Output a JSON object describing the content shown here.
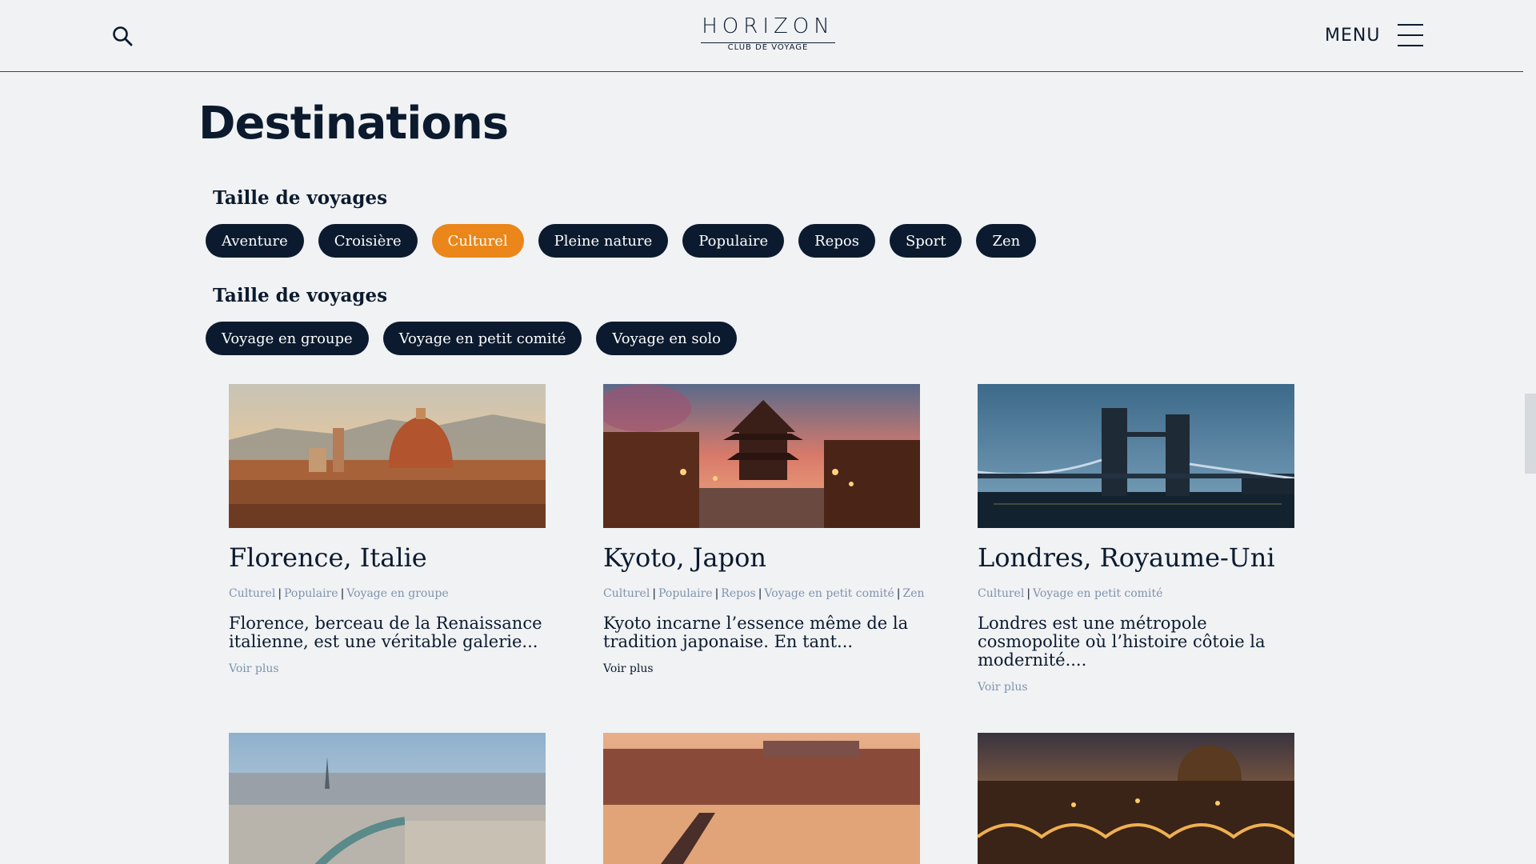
{
  "header": {
    "search_icon": "search-icon",
    "logo": {
      "main": "HORIZON",
      "sub": "CLUB DE VOYAGE"
    },
    "menu_label": "MENU",
    "menu_icon": "hamburger-icon"
  },
  "page_title": "Destinations",
  "filters": [
    {
      "heading": "Taille de voyages",
      "chips": [
        {
          "label": "Aventure",
          "active": false
        },
        {
          "label": "Croisière",
          "active": false
        },
        {
          "label": "Culturel",
          "active": true
        },
        {
          "label": "Pleine nature",
          "active": false
        },
        {
          "label": "Populaire",
          "active": false
        },
        {
          "label": "Repos",
          "active": false
        },
        {
          "label": "Sport",
          "active": false
        },
        {
          "label": "Zen",
          "active": false
        }
      ]
    },
    {
      "heading": "Taille de voyages",
      "chips": [
        {
          "label": "Voyage en groupe",
          "active": false
        },
        {
          "label": "Voyage en petit comité",
          "active": false
        },
        {
          "label": "Voyage en solo",
          "active": false
        }
      ]
    }
  ],
  "colors": {
    "navy": "#0b1a2e",
    "accent": "#ea861a",
    "tag": "#7f93ad",
    "background": "#f0f2f4"
  },
  "cards": [
    {
      "title": "Florence, Italie",
      "tags": [
        "Culturel",
        "Populaire",
        "Voyage en groupe"
      ],
      "description": "Florence, berceau de la Renaissance italienne, est une véritable galerie...",
      "more": "Voir plus",
      "more_hover": false,
      "image": "florence-photo"
    },
    {
      "title": "Kyoto, Japon",
      "tags": [
        "Culturel",
        "Populaire",
        "Repos",
        "Voyage en petit comité",
        "Zen"
      ],
      "description": "Kyoto incarne l’essence même de la tradition japonaise. En tant...",
      "more": "Voir plus",
      "more_hover": true,
      "image": "kyoto-photo"
    },
    {
      "title": "Londres, Royaume-Uni",
      "tags": [
        "Culturel",
        "Voyage en petit comité"
      ],
      "description": "Londres est une métropole cosmopolite où l’histoire côtoie la modernité....",
      "more": "Voir plus",
      "more_hover": false,
      "image": "london-photo"
    },
    {
      "image": "paris-photo"
    },
    {
      "image": "prague-photo"
    },
    {
      "image": "rome-photo"
    }
  ]
}
